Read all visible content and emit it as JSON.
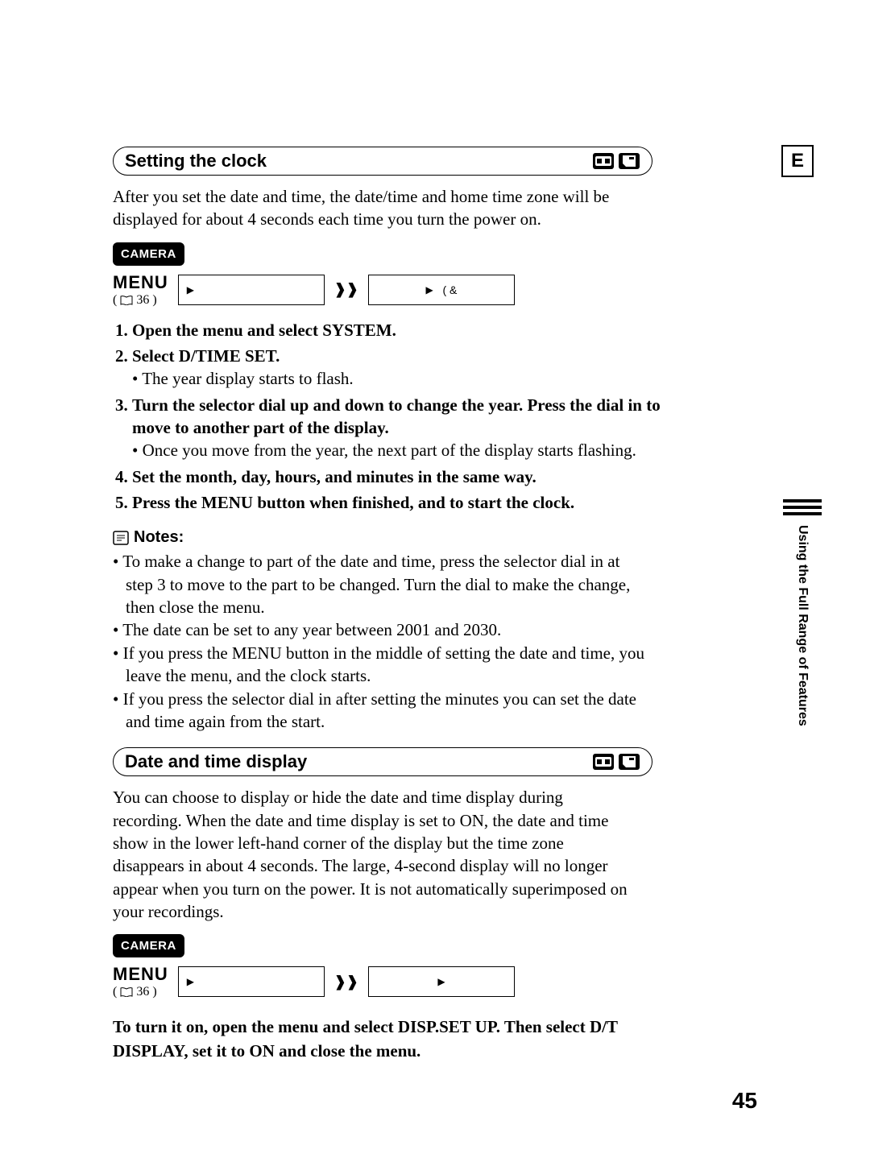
{
  "corner_letter": "E",
  "side_tab": "Using the Full\nRange of Features",
  "section1": {
    "title": "Setting the clock",
    "intro": "After you set the date and time, the date/time and home time zone will be displayed for about 4 seconds each time you turn the power on.",
    "badge": "CAMERA",
    "menu_label": "MENU",
    "page_ref": "36",
    "box2_text": "( &",
    "steps": [
      {
        "text": "Open the menu and select SYSTEM."
      },
      {
        "text": "Select D/TIME SET.",
        "sub": "The year display starts to flash."
      },
      {
        "text": "Turn the selector dial up and down to change the year. Press the dial in to move to another part of the display.",
        "sub": "Once you move from the year, the next part of the display starts flashing."
      },
      {
        "text": "Set the month, day, hours, and minutes in the same way."
      },
      {
        "text": "Press the MENU button when finished, and to start the clock."
      }
    ],
    "notes_label": "Notes:",
    "notes": [
      "To make a change to part of the date and time, press the selector dial in at step 3 to move to the part to be changed. Turn the dial to make the change, then close the menu.",
      "The date can be set to any year between 2001 and 2030.",
      "If you press the MENU button in the middle of setting the date and time, you leave the menu, and the clock starts.",
      "If you press the selector dial in after setting the minutes you can set the date and time again from the start."
    ]
  },
  "section2": {
    "title": "Date and time display",
    "intro": "You can choose to display or hide the date and time display during recording. When the date and time display is set to ON, the date and time show in the lower left-hand corner of the display but the time zone disappears in about 4 seconds. The large, 4-second display will no longer appear when you turn on the power. It is not automatically superimposed on your recordings.",
    "badge": "CAMERA",
    "menu_label": "MENU",
    "page_ref": "36",
    "final": "To turn it on, open the menu and select DISP.SET UP. Then select D/T DISPLAY, set it to ON and close the menu."
  },
  "page_number": "45"
}
